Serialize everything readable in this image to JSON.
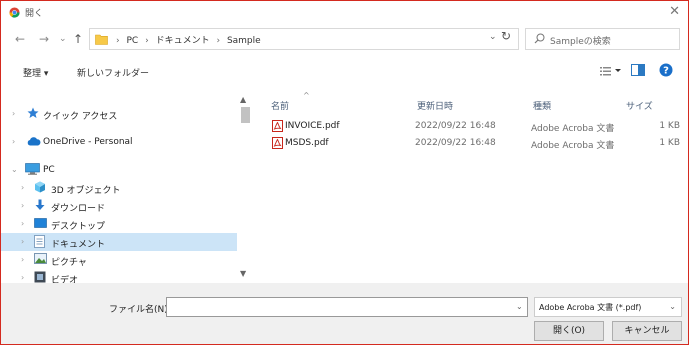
{
  "window": {
    "title": "開く",
    "close_glyph": "✕"
  },
  "nav_buttons": {
    "back": "←",
    "forward": "→",
    "recent": "⌄",
    "up": "↑"
  },
  "address": {
    "crumbs": [
      "PC",
      "ドキュメント",
      "Sample"
    ],
    "separator": "›",
    "refresh": "↻"
  },
  "search": {
    "placeholder": "Sampleの検索"
  },
  "toolbar": {
    "organize": "整理 ▾",
    "new_folder": "新しいフォルダー"
  },
  "nav_pane": {
    "items": [
      {
        "label": "クイック アクセス",
        "icon": "star-icon"
      },
      {
        "label": "OneDrive - Personal",
        "icon": "cloud-icon"
      },
      {
        "label": "PC",
        "icon": "computer-icon"
      },
      {
        "label": "3D オブジェクト",
        "icon": "cube-icon"
      },
      {
        "label": "ダウンロード",
        "icon": "download-icon"
      },
      {
        "label": "デスクトップ",
        "icon": "desktop-icon"
      },
      {
        "label": "ドキュメント",
        "icon": "documents-icon",
        "selected": true
      },
      {
        "label": "ピクチャ",
        "icon": "pictures-icon"
      },
      {
        "label": "ビデオ",
        "icon": "videos-icon"
      }
    ]
  },
  "columns": {
    "name": "名前",
    "date": "更新日時",
    "type": "種類",
    "size": "サイズ"
  },
  "files": [
    {
      "name": "INVOICE.pdf",
      "date": "2022/09/22 16:48",
      "type": "Adobe Acroba 文書",
      "size": "1 KB"
    },
    {
      "name": "MSDS.pdf",
      "date": "2022/09/22 16:48",
      "type": "Adobe Acroba 文書",
      "size": "1 KB"
    }
  ],
  "footer": {
    "filename_label": "ファイル名(N):",
    "filename_value": "",
    "filter": "Adobe Acroba 文書 (*.pdf)",
    "open_button": "開く(O)",
    "cancel_button": "キャンセル"
  },
  "colors": {
    "accent": "#0078d7",
    "selection": "#cce4f7",
    "frame": "#d42a1f"
  }
}
